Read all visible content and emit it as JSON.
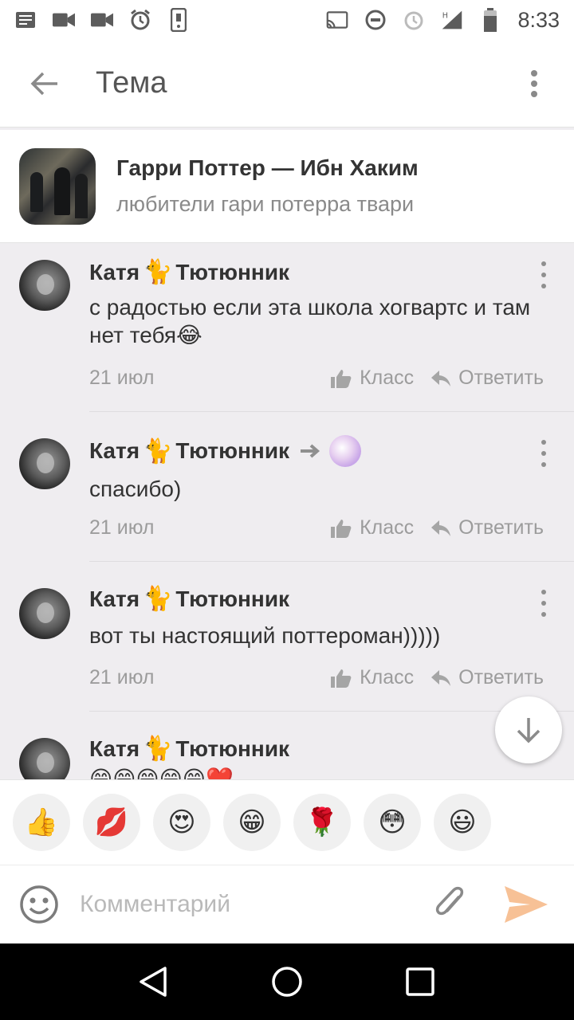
{
  "status_bar": {
    "time": "8:33",
    "left_icons": [
      "news-icon",
      "video-icon",
      "video-icon",
      "alarm-icon",
      "phone-icon"
    ],
    "right_icons": [
      "cast-icon",
      "dnd-icon",
      "alarm-icon",
      "signal-icon",
      "battery-icon"
    ]
  },
  "app_bar": {
    "title": "Тема"
  },
  "group": {
    "name": "Гарри Поттер — Ибн Хаким",
    "subtitle": "любители гари потерра твари"
  },
  "comments": [
    {
      "author_first": "Катя",
      "author_emoji": "🐈",
      "author_last": "Тютюнник",
      "text": "с радостью если эта школа хогвартс и там нет тебя😂",
      "date": "21 июл",
      "like_label": "Класс",
      "reply_label": "Ответить",
      "reply_to_user": false
    },
    {
      "author_first": "Катя",
      "author_emoji": "🐈",
      "author_last": "Тютюнник",
      "text": "спасибо)",
      "date": "21 июл",
      "like_label": "Класс",
      "reply_label": "Ответить",
      "reply_to_user": true
    },
    {
      "author_first": "Катя",
      "author_emoji": "🐈",
      "author_last": "Тютюнник",
      "text": "вот ты настоящий поттероман)))))",
      "date": "21 июл",
      "like_label": "Класс",
      "reply_label": "Ответить",
      "reply_to_user": false
    },
    {
      "author_first": "Катя",
      "author_emoji": "🐈",
      "author_last": "Тютюнник",
      "text": "😁😁😁😁😁❤️",
      "date": "",
      "like_label": "",
      "reply_label": "",
      "reply_to_user": false
    }
  ],
  "stickers": [
    "👍",
    "💋",
    "😍",
    "😁",
    "🌹",
    "😳",
    "😃"
  ],
  "input": {
    "placeholder": "Комментарий"
  },
  "colors": {
    "accent": "#f59b27",
    "send": "#f7c196",
    "background": "#efedf0"
  }
}
